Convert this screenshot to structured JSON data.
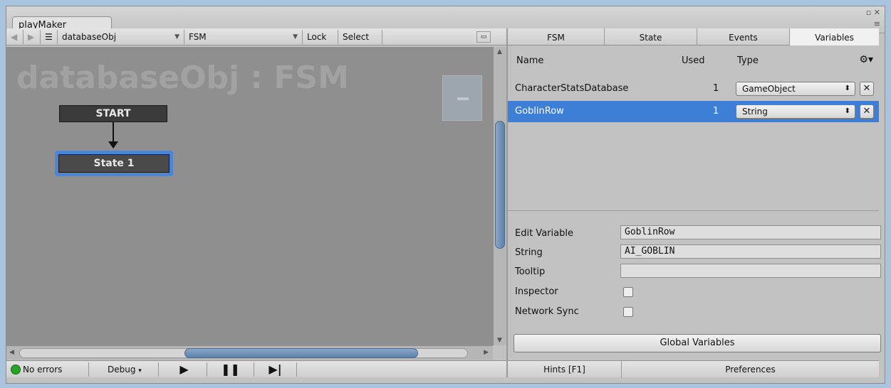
{
  "window": {
    "tab_title": "playMaker",
    "icons": [
      "restore-icon",
      "close-icon",
      "menu-icon"
    ]
  },
  "toolbar": {
    "fsm_owner": "databaseObj",
    "fsm_name": "FSM",
    "lock_label": "Lock",
    "select_label": "Select"
  },
  "graph": {
    "title": "databaseObj : FSM",
    "start_label": "START",
    "state_label": "State 1"
  },
  "status_bar": {
    "errors_label": "No errors",
    "debug_label": "Debug"
  },
  "tabs": [
    "FSM",
    "State",
    "Events",
    "Variables"
  ],
  "active_tab": "Variables",
  "variables_table": {
    "headers": {
      "name": "Name",
      "used": "Used",
      "type": "Type"
    },
    "rows": [
      {
        "name": "CharacterStatsDatabase",
        "used": "1",
        "type": "GameObject",
        "selected": false
      },
      {
        "name": "GoblinRow",
        "used": "1",
        "type": "String",
        "selected": true
      }
    ]
  },
  "edit_variable": {
    "edit_label": "Edit Variable",
    "edit_value": "GoblinRow",
    "string_label": "String",
    "string_value": "AI_GOBLIN",
    "tooltip_label": "Tooltip",
    "tooltip_value": "",
    "inspector_label": "Inspector",
    "network_sync_label": "Network Sync"
  },
  "buttons": {
    "global_variables": "Global Variables",
    "hints": "Hints [F1]",
    "preferences": "Preferences"
  },
  "colors": {
    "selection": "#3d7fd6",
    "state_highlight": "#4b86d6",
    "status_ok": "#27a327"
  }
}
